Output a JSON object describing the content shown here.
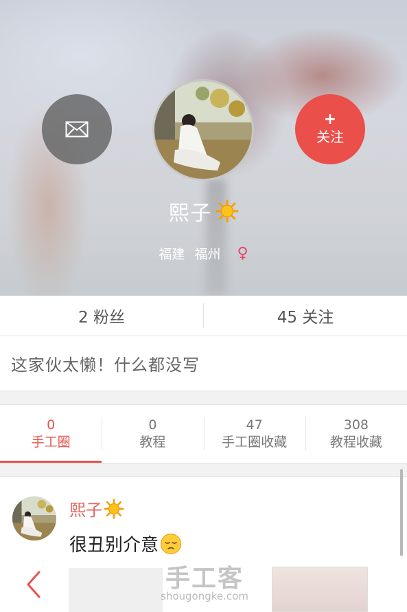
{
  "profile": {
    "name": "熙子",
    "province": "福建",
    "city": "福州",
    "gender_symbol": "♀",
    "follow_plus": "+",
    "follow_label": "关注",
    "bio": "这家伙太懒！什么都没写"
  },
  "stats": {
    "fans": "2 粉丝",
    "following": "45 关注"
  },
  "tabs": [
    {
      "count": "0",
      "label": "手工圈",
      "active": true
    },
    {
      "count": "0",
      "label": "教程",
      "active": false
    },
    {
      "count": "47",
      "label": "手工圈收藏",
      "active": false
    },
    {
      "count": "308",
      "label": "教程收藏",
      "active": false
    }
  ],
  "feed": [
    {
      "author": "熙子",
      "text": "很丑别介意"
    }
  ],
  "watermark": {
    "cn": "手工客",
    "en": "shougongke.com"
  },
  "colors": {
    "accent": "#e8524d",
    "follow_button": "#ea4f4a",
    "gender": "#e7466c"
  },
  "icons": {
    "message": "mail-icon",
    "back": "chevron-left-icon",
    "sun": "sun-emoji-icon",
    "pensive": "pensive-emoji-icon"
  }
}
